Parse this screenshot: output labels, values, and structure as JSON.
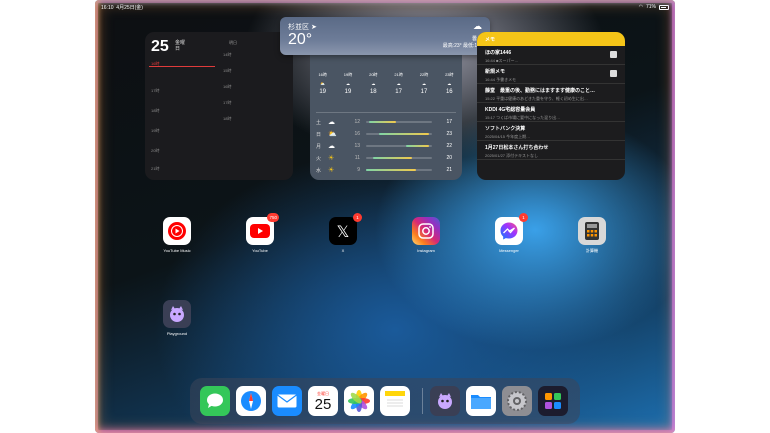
{
  "status": {
    "time": "16:10",
    "date": "4月25日(金)",
    "battery": "71%"
  },
  "calendar": {
    "day": "25",
    "weekday": "金曜日",
    "header": "明日",
    "now": "16時",
    "hours": [
      "17時",
      "18時",
      "19時",
      "20時",
      "21時",
      "22時"
    ],
    "right_hours": [
      "14時",
      "15時",
      "16時",
      "17時",
      "18時"
    ]
  },
  "weather_banner": {
    "location": "杉並区 ➤",
    "temp": "20°",
    "condition": "曇り",
    "hilo": "最高:23° 最低:15°"
  },
  "weather": {
    "hourly": [
      {
        "time": "16時",
        "temp": "19"
      },
      {
        "time": "19時",
        "temp": "19"
      },
      {
        "time": "20時",
        "temp": "18"
      },
      {
        "time": "21時",
        "temp": "17"
      },
      {
        "time": "22時",
        "temp": "17"
      },
      {
        "time": "23時",
        "temp": "16"
      }
    ],
    "daily": [
      {
        "day": "土",
        "icon": "cloud",
        "lo": "12",
        "hi": "17",
        "bar_start": 0.05,
        "bar_end": 0.45
      },
      {
        "day": "日",
        "icon": "partly-sunny",
        "lo": "16",
        "hi": "23",
        "bar_start": 0.2,
        "bar_end": 0.95
      },
      {
        "day": "月",
        "icon": "cloud",
        "lo": "13",
        "hi": "22",
        "bar_start": 0.6,
        "bar_end": 0.95
      },
      {
        "day": "火",
        "icon": "sun",
        "lo": "11",
        "hi": "20",
        "bar_start": 0.1,
        "bar_end": 0.7
      },
      {
        "day": "水",
        "icon": "sun",
        "lo": "9",
        "hi": "21",
        "bar_start": 0.0,
        "bar_end": 0.75
      }
    ]
  },
  "notes": {
    "title": "メモ",
    "items": [
      {
        "title": "ほの家1446",
        "sub": "16:44  ■スーパー…"
      },
      {
        "title": "新規メモ",
        "sub": "16:44  予書きメモ"
      },
      {
        "title": "藤堂　最重の後、勤務にはますます健康のこと…",
        "sub": "15:22  平重は健康のあどきた重を守り、軽く初め生に出…"
      },
      {
        "title": "KDDI 4G宅総容量会員",
        "sub": "15:17  つくば市場に要中になった混り出…"
      },
      {
        "title": "ソフトバンク決算",
        "sub": "2025/04/15  今年度上期…"
      },
      {
        "title": "1月27日松本さん打ち合わせ",
        "sub": "2025/01/27  添付テキストなし"
      }
    ]
  },
  "apps": [
    {
      "label": "YouTube Music",
      "badge": ""
    },
    {
      "label": "YouTube",
      "badge": "750"
    },
    {
      "label": "X",
      "badge": "1"
    },
    {
      "label": "Instagram",
      "badge": ""
    },
    {
      "label": "Messenger",
      "badge": "1"
    },
    {
      "label": "計算機",
      "badge": ""
    },
    {
      "label": "Playground",
      "badge": ""
    }
  ],
  "dock": {
    "calendar_day": "25"
  }
}
